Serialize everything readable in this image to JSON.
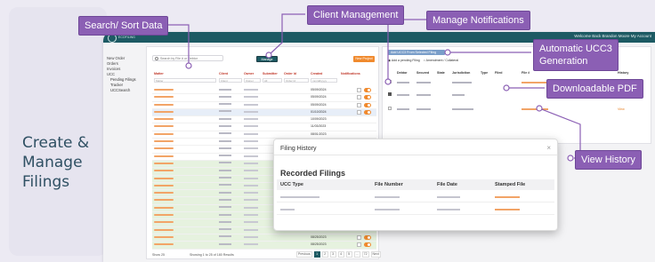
{
  "left_title": [
    "Create &",
    "Manage",
    "Filings"
  ],
  "callouts": {
    "search_sort": "Search/ Sort Data",
    "client_management": "Client Management",
    "manage_notifications": "Manage Notifications",
    "automatic_ucc3": [
      "Automatic UCC3",
      "Generation"
    ],
    "downloadable_pdf": "Downloadable PDF",
    "view_history": "View History"
  },
  "app": {
    "logo_text": "ECOFILING",
    "welcome": "Welcome Back Brandon Moore My Account",
    "sidebar": [
      "New Order",
      "Orders",
      "Invoices",
      "UCC"
    ],
    "sidebar_sub": [
      "Pending Filings",
      "Tracker",
      "UCCSearch"
    ],
    "search_placeholder": "Search by File # or Debtor",
    "manage_clients": "Manage Clients",
    "new_project": "New Project",
    "columns": [
      "Matter",
      "Client",
      "Owner",
      "Submitter",
      "Order Id",
      "Created",
      "Notifications"
    ],
    "filters": [
      "Matter",
      "Client",
      "Owner",
      "All",
      "Order Id",
      "mm/dd/yyyy"
    ],
    "visible_dates": [
      "05/09/2024",
      "05/09/2024",
      "05/09/2024",
      "01/10/2024",
      "10/09/2023",
      "11/03/2023",
      "08/01/2023",
      "08/25/2023",
      "08/25/2023"
    ],
    "show_label": "Show",
    "show_value": "25",
    "count_label": "Showing 1 to 25 of 180 Results",
    "pager": [
      "Previous",
      "1",
      "2",
      "3",
      "4",
      "5",
      "...",
      "72",
      "Next"
    ],
    "colors": {
      "brand": "#1d5a63",
      "accent": "#f08a2e",
      "callout": "#8b5fb4"
    }
  },
  "right_panel": {
    "ucc3_button": "Add UCC3 From Selected Filing",
    "radio_pending": "Add a pending Filing",
    "radio_collateral": "Amendment / Collateral",
    "columns": [
      "Debtor",
      "Secured",
      "State",
      "Jurisdiction",
      "Type",
      "Filed",
      "File #",
      "History"
    ],
    "view_label": "View"
  },
  "modal": {
    "title": "Filing History",
    "close": "×",
    "subtitle": "Recorded Filings",
    "columns": [
      "UCC Type",
      "File Number",
      "File Date",
      "Stamped File"
    ]
  }
}
